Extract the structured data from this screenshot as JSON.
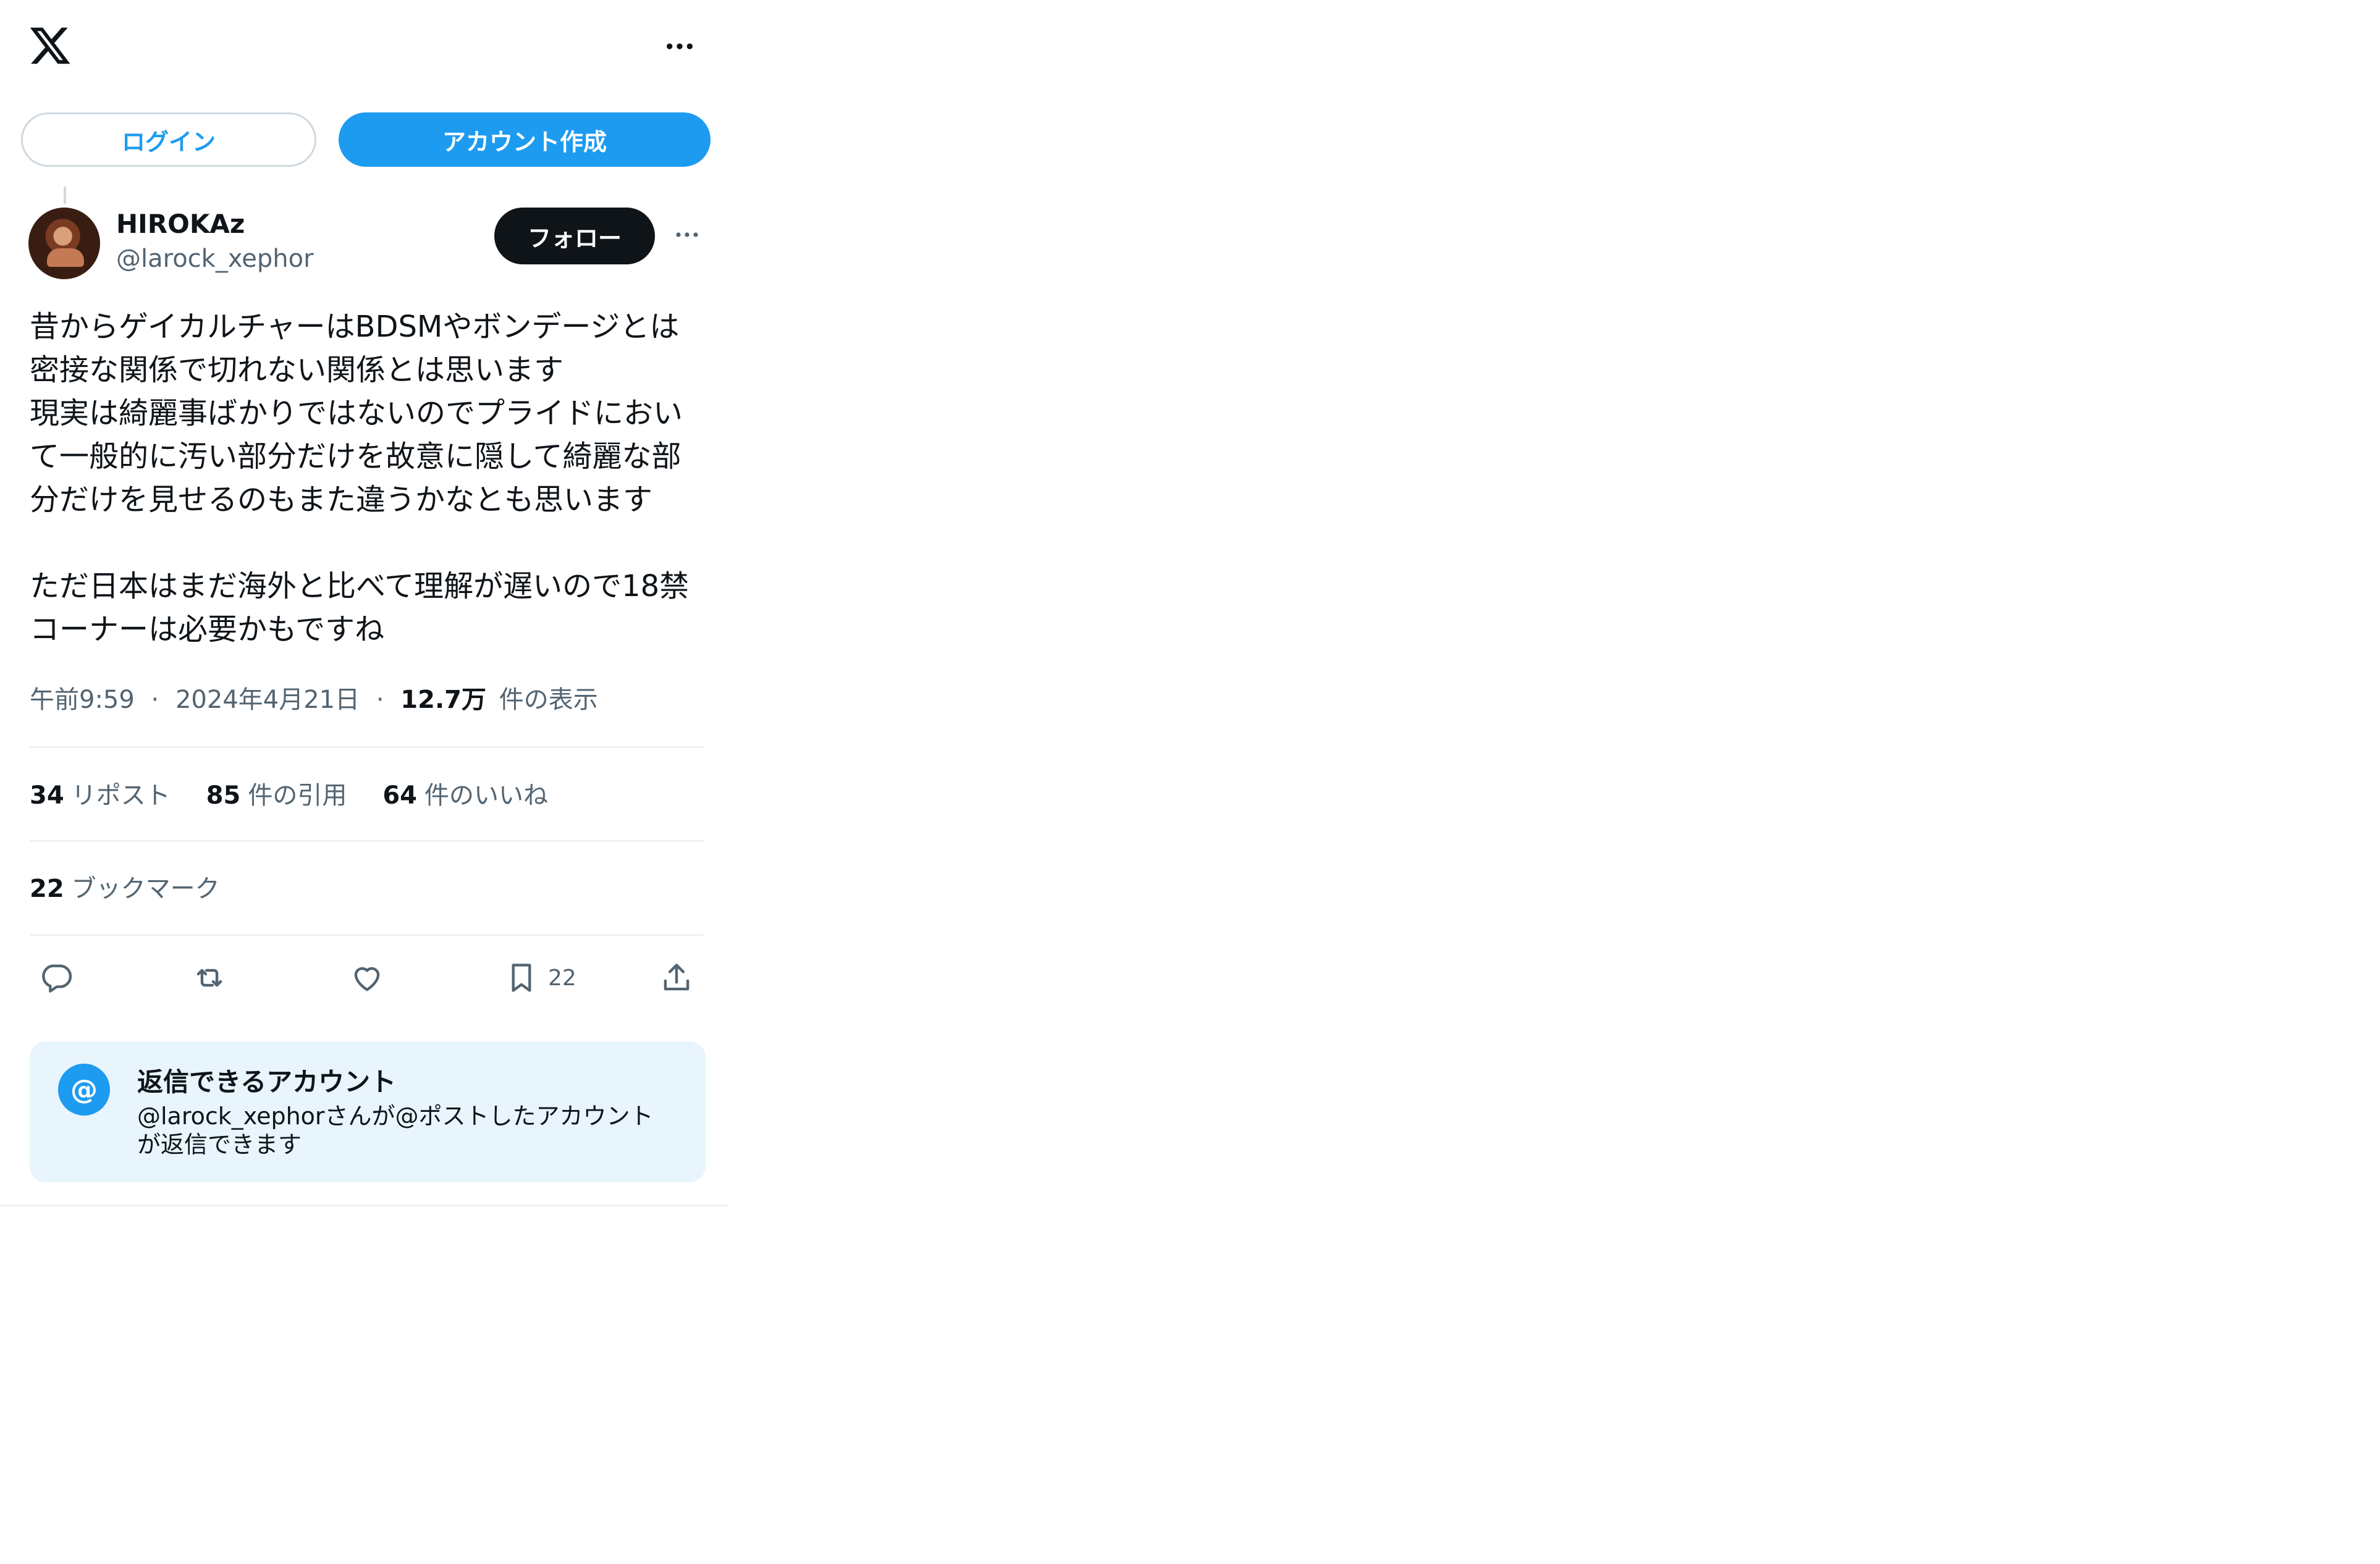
{
  "header": {
    "logo_icon": "x-logo-icon",
    "more_icon": "more-horizontal-icon"
  },
  "auth": {
    "login_label": "ログイン",
    "signup_label": "アカウント作成"
  },
  "post": {
    "author_name": "HIROKAz",
    "author_handle": "@larock_xephor",
    "follow_label": "フォロー",
    "text": "昔からゲイカルチャーはBDSMやボンデージとは\n密接な関係で切れない関係とは思います\n現実は綺麗事ばかりではないのでプライドにおい\nて一般的に汚い部分だけを故意に隠して綺麗な部\n分だけを見せるのもまた違うかなとも思います\n\nただ日本はまだ海外と比べて理解が遅いので18禁\nコーナーは必要かもですね",
    "time": "午前9:59",
    "date": "2024年4月21日",
    "separator": "·",
    "views_count": "12.7万",
    "views_label": "件の表示"
  },
  "stats": {
    "reposts_count": "34",
    "reposts_label": "リポスト",
    "quotes_count": "85",
    "quotes_label": "件の引用",
    "likes_count": "64",
    "likes_label": "件のいいね",
    "bookmarks_count": "22",
    "bookmarks_label": "ブックマーク"
  },
  "actions": {
    "reply_icon": "reply-icon",
    "repost_icon": "repost-icon",
    "like_icon": "heart-icon",
    "bookmark_icon": "bookmark-icon",
    "bookmark_count": "22",
    "share_icon": "share-icon"
  },
  "reply_restriction": {
    "icon_glyph": "@",
    "title": "返信できるアカウント",
    "description": "@larock_xephorさんが@ポストしたアカウント\nが返信できます"
  },
  "colors": {
    "accent": "#1d9bf0",
    "text_primary": "#0f1419",
    "text_secondary": "#536471",
    "divider": "#eff3f4",
    "reply_box_bg": "#e8f5fd"
  }
}
